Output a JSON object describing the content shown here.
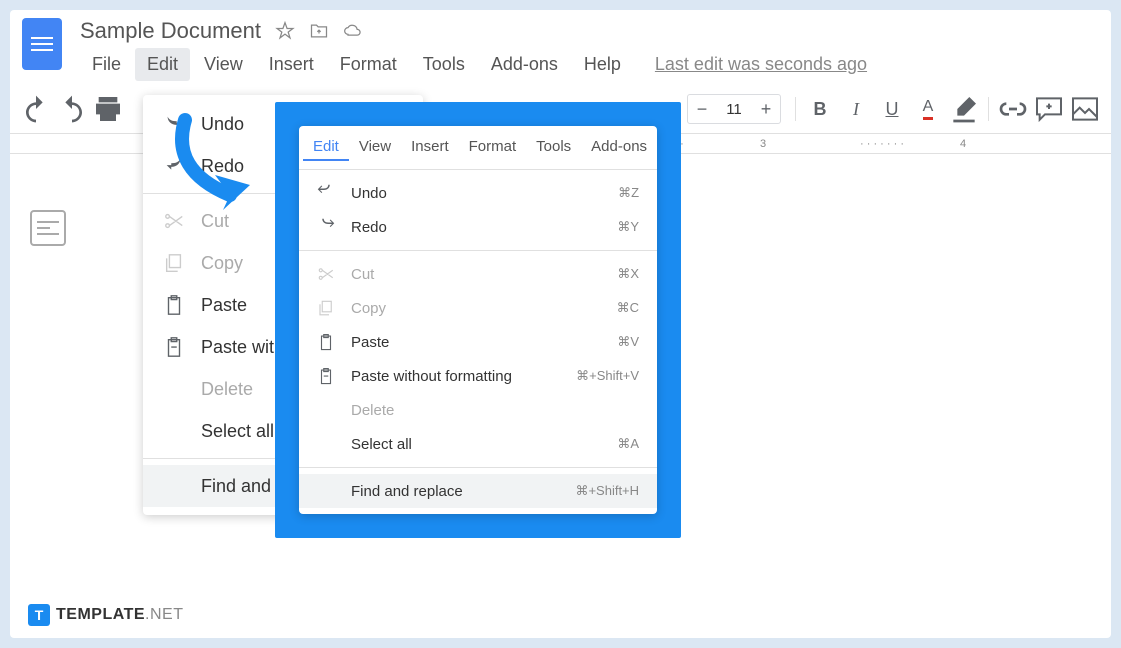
{
  "doc_title": "Sample Document",
  "menubar": {
    "file": "File",
    "edit": "Edit",
    "view": "View",
    "insert": "Insert",
    "format": "Format",
    "tools": "Tools",
    "addons": "Add-ons",
    "help": "Help"
  },
  "last_edit": "Last edit was seconds ago",
  "toolbar": {
    "font_size": "11"
  },
  "bg_menu": {
    "undo": "Undo",
    "redo": "Redo",
    "cut": "Cut",
    "copy": "Copy",
    "paste": "Paste",
    "paste_wo": "Paste wit",
    "delete": "Delete",
    "select_all": "Select all",
    "find": "Find and"
  },
  "callout_menubar": {
    "edit": "Edit",
    "view": "View",
    "insert": "Insert",
    "format": "Format",
    "tools": "Tools",
    "addons": "Add-ons"
  },
  "callout": {
    "undo": {
      "label": "Undo",
      "sc": "⌘Z"
    },
    "redo": {
      "label": "Redo",
      "sc": "⌘Y"
    },
    "cut": {
      "label": "Cut",
      "sc": "⌘X"
    },
    "copy": {
      "label": "Copy",
      "sc": "⌘C"
    },
    "paste": {
      "label": "Paste",
      "sc": "⌘V"
    },
    "paste_wo": {
      "label": "Paste without formatting",
      "sc": "⌘+Shift+V"
    },
    "delete": {
      "label": "Delete",
      "sc": ""
    },
    "select_all": {
      "label": "Select all",
      "sc": "⌘A"
    },
    "find": {
      "label": "Find and replace",
      "sc": "⌘+Shift+H"
    }
  },
  "ruler": {
    "t3": "3",
    "t4": "4"
  },
  "watermark": {
    "t": "T",
    "name": "TEMPLATE",
    "ext": ".NET"
  }
}
